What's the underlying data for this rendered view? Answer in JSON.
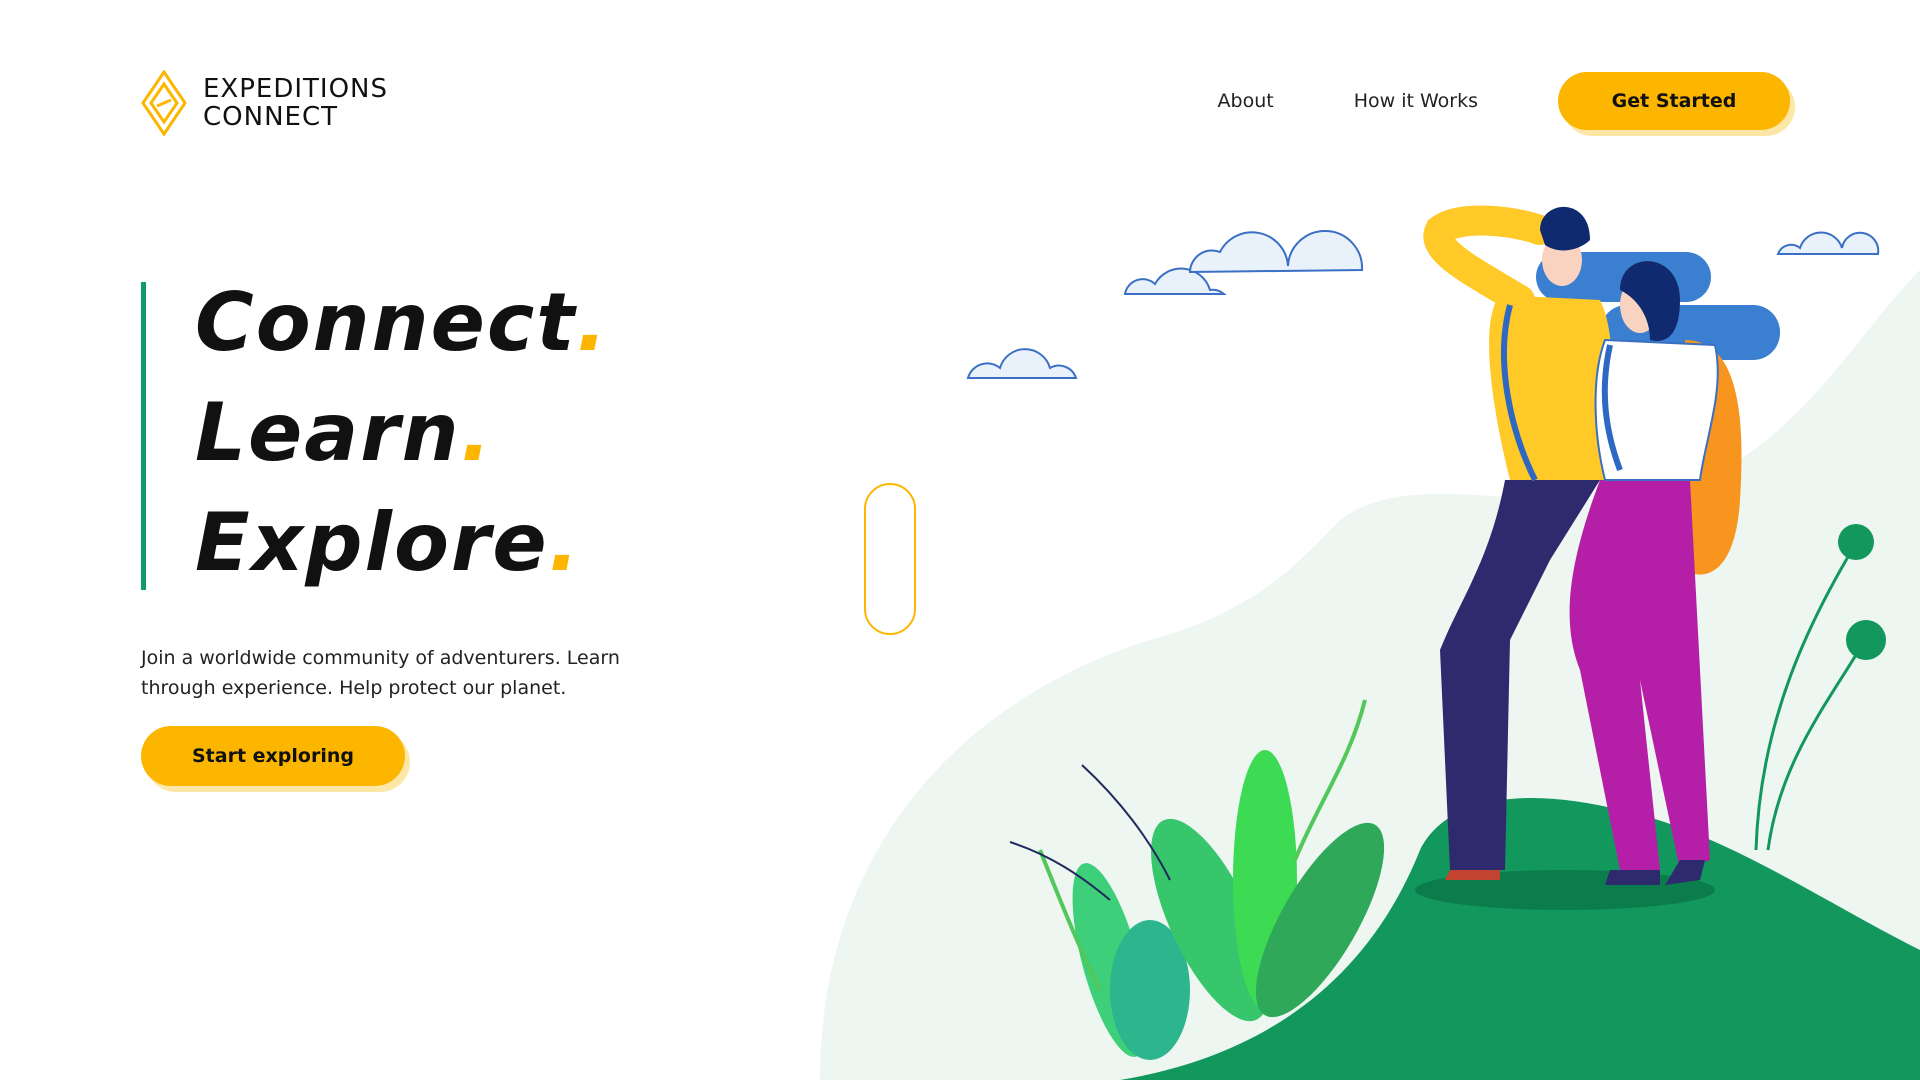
{
  "brand": {
    "line1": "EXPEDITIONS",
    "line2": "CONNECT",
    "accent": "#fdb600",
    "green": "#0e9a6a"
  },
  "nav": {
    "items": [
      {
        "label": "About"
      },
      {
        "label": "How it Works"
      }
    ],
    "cta_label": "Get Started"
  },
  "hero": {
    "lines": [
      {
        "word": "Connect",
        "dot": "."
      },
      {
        "word": "Learn",
        "dot": "."
      },
      {
        "word": "Explore",
        "dot": "."
      }
    ],
    "subtext": "Join a worldwide community of adventurers. Learn through experience. Help protect our planet.",
    "cta_label": "Start exploring"
  },
  "illustration": {
    "icons": [
      "cloud-icon",
      "hikers-illustration",
      "plant-icon",
      "hill-shape"
    ]
  }
}
